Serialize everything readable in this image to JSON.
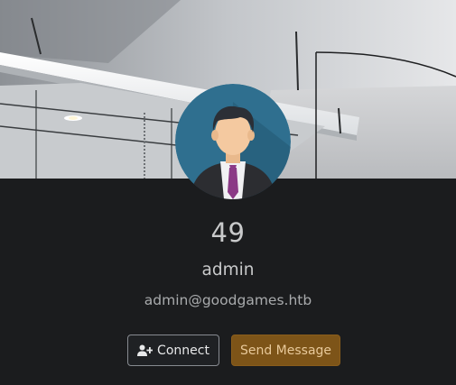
{
  "profile": {
    "user_id": "49",
    "username": "admin",
    "email": "admin@goodgames.htb"
  },
  "actions": {
    "connect_label": "Connect",
    "message_label": "Send Message"
  },
  "icons": {
    "connect": "user-plus-icon"
  },
  "colors": {
    "background": "#1b1c1e",
    "message_button": "#7d5418",
    "avatar_bg": "#2f6f8f"
  }
}
